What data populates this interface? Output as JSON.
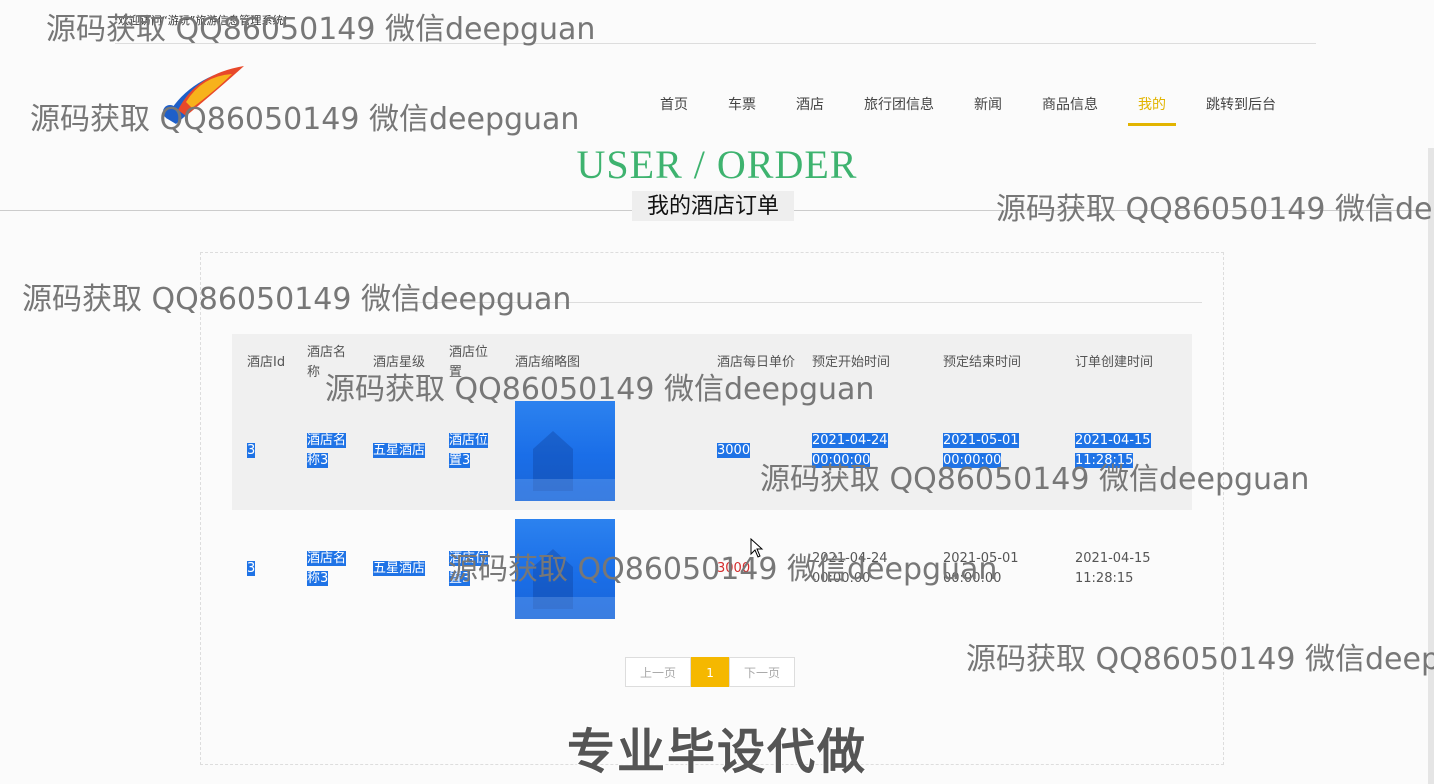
{
  "header": {
    "welcome": "欢迎访问“游玩”旅游信息管理系统!",
    "nav": [
      {
        "label": "首页"
      },
      {
        "label": "车票"
      },
      {
        "label": "酒店"
      },
      {
        "label": "旅行团信息"
      },
      {
        "label": "新闻"
      },
      {
        "label": "商品信息"
      },
      {
        "label": "我的",
        "active": true
      },
      {
        "label": "跳转到后台"
      }
    ]
  },
  "section": {
    "title_en": "USER / ORDER",
    "title_cn": "我的酒店订单"
  },
  "table": {
    "headers": [
      "酒店Id",
      "酒店名称",
      "酒店星级",
      "酒店位置",
      "酒店缩略图",
      "酒店每日单价",
      "预定开始时间",
      "预定结束时间",
      "订单创建时间"
    ],
    "rows": [
      {
        "id": "3",
        "name": "酒店名称3",
        "star": "五星酒店",
        "location": "酒店位置3",
        "price": "3000",
        "start": "2021-04-24 00:00:00",
        "end": "2021-05-01 00:00:00",
        "created": "2021-04-15 11:28:15"
      },
      {
        "id": "3",
        "name": "酒店名称3",
        "star": "五星酒店",
        "location": "酒店位置3",
        "price": "3000",
        "start": "2021-04-24 00:00:00",
        "end": "2021-05-01 00:00:00",
        "created": "2021-04-15 11:28:15"
      }
    ]
  },
  "pager": {
    "prev": "上一页",
    "current": "1",
    "next": "下一页"
  },
  "watermark": "源码获取 QQ86050149 微信deepguan",
  "promo": "专业毕设代做",
  "colors": {
    "accent": "#e2b400",
    "title_green": "#3eb36f",
    "selection": "#1f73e6",
    "price_red": "#d42b2b"
  }
}
